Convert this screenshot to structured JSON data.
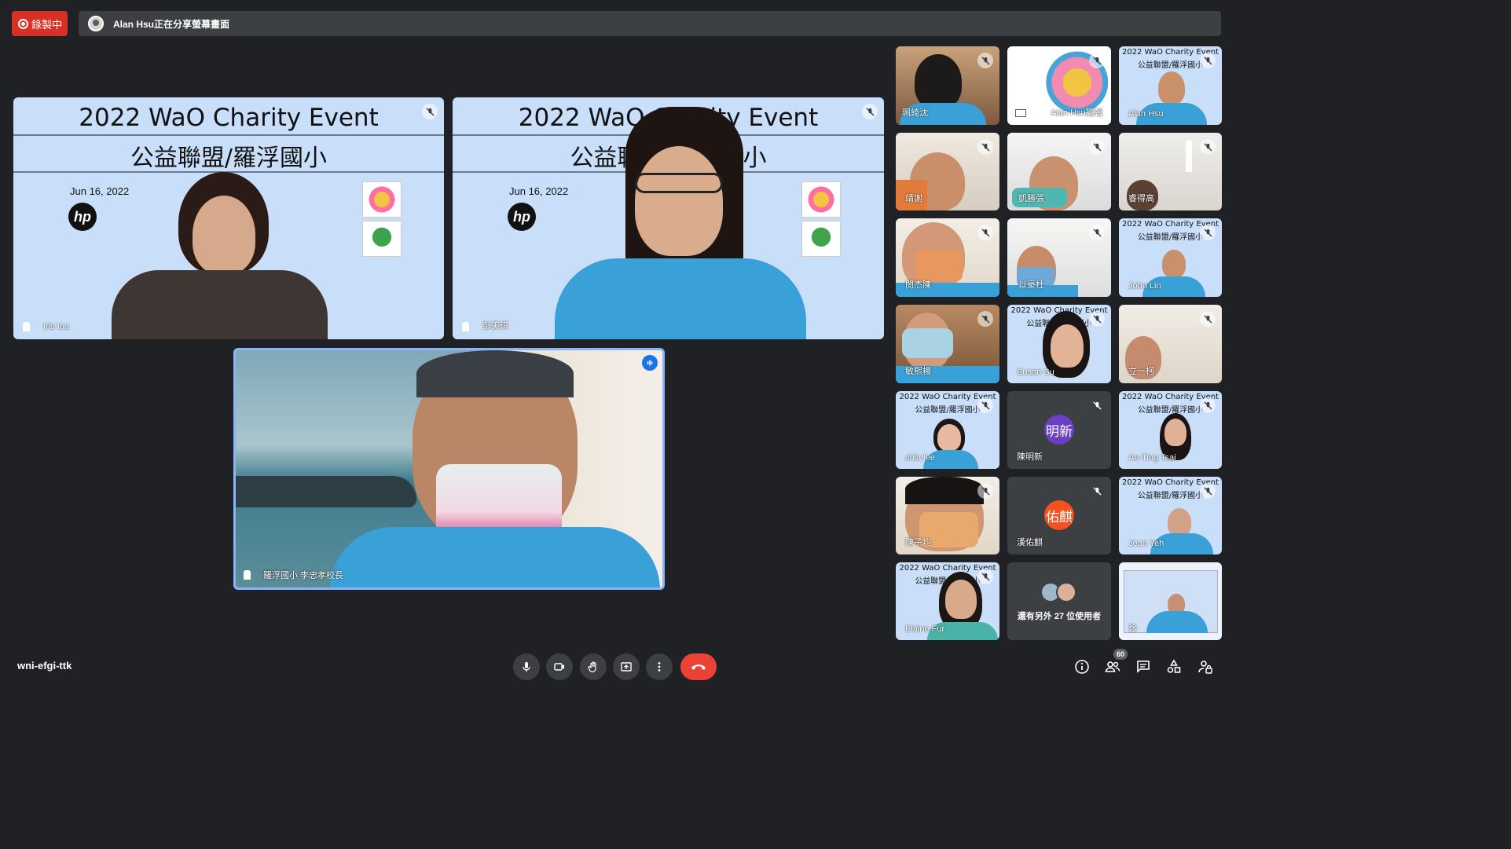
{
  "recording": {
    "label": "錄製中"
  },
  "share_banner": {
    "text": "Alan Hsu正在分享螢幕畫面"
  },
  "slide": {
    "title": "2022 WaO Charity Event",
    "subtitle": "公益聯盟/羅浮國小",
    "date": "Jun 16, 2022",
    "hp_logo": "hp"
  },
  "main_tiles": [
    {
      "name": "Iris Iou"
    },
    {
      "name": "彭美琪"
    },
    {
      "name": "羅浮國小 李忠孝校長"
    }
  ],
  "grid": [
    {
      "name": "珮綺沈"
    },
    {
      "name": "Alan Hsu簡報"
    },
    {
      "name": "Alan Hsu"
    },
    {
      "name": "靖謝"
    },
    {
      "name": "凱勝張"
    },
    {
      "name": "睿得高"
    },
    {
      "name": "閔杰陳"
    },
    {
      "name": "以豪杜"
    },
    {
      "name": "John Lin"
    },
    {
      "name": "敏熙楊"
    },
    {
      "name": "Susan Su"
    },
    {
      "name": "立一柯"
    },
    {
      "name": "chia lee"
    },
    {
      "name": "陳明新",
      "initials": "明新"
    },
    {
      "name": "An-Ting Tsai"
    },
    {
      "name": "陳子均"
    },
    {
      "name": "漢佑麒",
      "initials": "佑麒"
    },
    {
      "name": "Jean Yeh"
    },
    {
      "name": "Elaine Fur"
    },
    {
      "name": "還有另外 27 位使用者"
    },
    {
      "name": "徐"
    }
  ],
  "meeting_code": "wni-efgi-ttk",
  "participant_count": "60",
  "colors": {
    "background": "#202124",
    "end_call": "#ea4335",
    "slide_bg": "#c9def9",
    "record": "#d93025"
  }
}
